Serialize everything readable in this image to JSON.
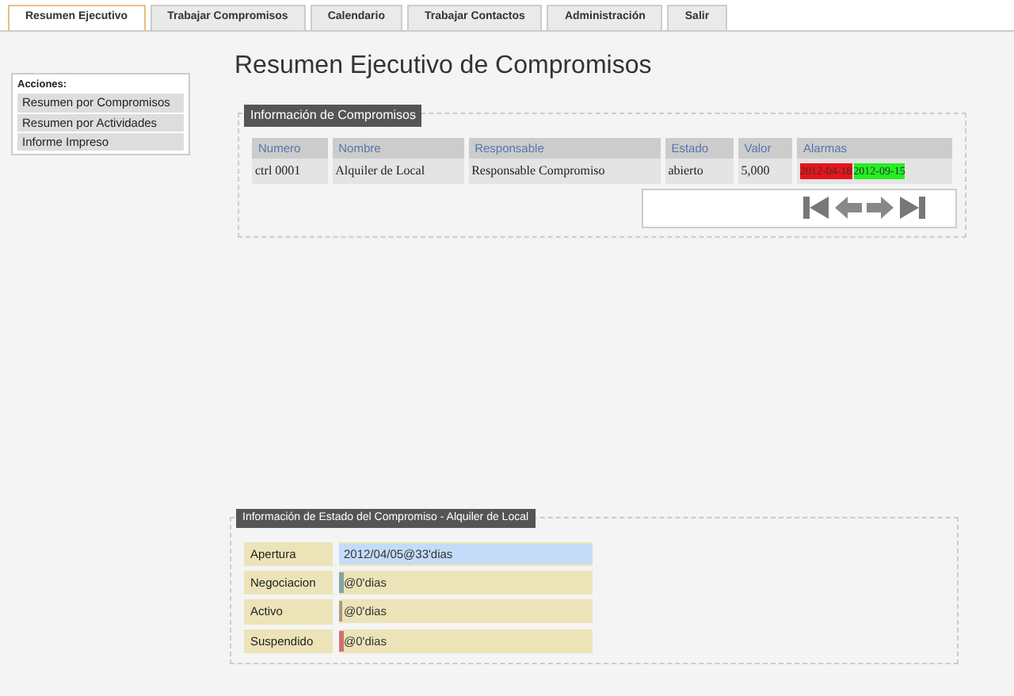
{
  "tabs": [
    {
      "label": "Resumen Ejecutivo",
      "selected": true
    },
    {
      "label": "Trabajar Compromisos",
      "selected": false
    },
    {
      "label": "Calendario",
      "selected": false
    },
    {
      "label": "Trabajar Contactos",
      "selected": false
    },
    {
      "label": "Administración",
      "selected": false
    },
    {
      "label": "Salir",
      "selected": false
    }
  ],
  "sidebar": {
    "title": "Acciones:",
    "items": [
      "Resumen por Compromisos",
      "Resumen por Actividades",
      "Informe Impreso"
    ]
  },
  "page_title": "Resumen Ejecutivo de Compromisos",
  "compromisos": {
    "legend": "Información de Compromisos",
    "columns": [
      "Numero",
      "Nombre",
      "Responsable",
      "Estado",
      "Valor",
      "Alarmas"
    ],
    "rows": [
      {
        "numero": "ctrl 0001",
        "nombre": "Alquiler de Local",
        "responsable": "Responsable Compromiso",
        "estado": "abierto",
        "valor": "5,000",
        "alarmas": [
          {
            "text": "2012-04-18",
            "color": "#e8141a"
          },
          {
            "text": "2012-09-15",
            "color": "#22f022"
          }
        ]
      }
    ]
  },
  "estado": {
    "legend": "Información de Estado del Compromiso - Alquiler de Local",
    "stages": [
      {
        "label": "Apertura",
        "value": "2012/04/05@33'dias",
        "level": 1,
        "color": "#c4dcf8"
      },
      {
        "label": "Negociacion",
        "value": "@0'dias",
        "level": 0.02,
        "color": "#7fa8a0"
      },
      {
        "label": "Activo",
        "value": "@0'dias",
        "level": 0.015,
        "color": "#a89c7c"
      },
      {
        "label": "Suspendido",
        "value": "@0'dias",
        "level": 0.02,
        "color": "#d07070"
      }
    ]
  }
}
